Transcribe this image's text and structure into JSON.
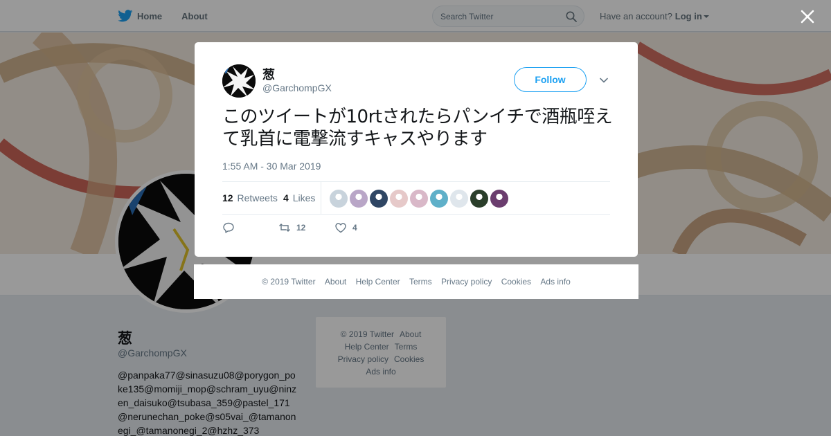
{
  "nav": {
    "home_label": "Home",
    "about_label": "About",
    "search_placeholder": "Search Twitter",
    "account_prompt": "Have an account?",
    "login_label": "Log in",
    "icons": [
      "twitter-bird-icon",
      "search-icon",
      "caret-down-icon",
      "close-icon"
    ]
  },
  "profile": {
    "name": "葱",
    "handle": "@GarchompGX",
    "bio": "@panpaka77@sinasuzu08@porygon_poke135@momiji_mop@schram_uyu@ninzen_daisuko@tsubasa_359@pastel_171@nerunechan_poke@s05vai_@tamanonegi_@tamanonegi_2@hzhz_373"
  },
  "side_footer": {
    "links": [
      "© 2019 Twitter",
      "About",
      "Help Center",
      "Terms",
      "Privacy policy",
      "Cookies",
      "Ads info"
    ]
  },
  "tweet": {
    "name": "葱",
    "handle": "@GarchompGX",
    "follow_label": "Follow",
    "text": "このツイートが10rtされたらパンイチで酒瓶咥えて乳首に電撃流すキャスやります",
    "timestamp": "1:55 AM - 30 Mar 2019",
    "retweets_count": "12",
    "retweets_label": "Retweets",
    "likes_count": "4",
    "likes_label": "Likes",
    "reply_count": "",
    "retweet_action_count": "12",
    "like_action_count": "4",
    "liker_colors": [
      "#c8d3dc",
      "#b9a6c7",
      "#2f4664",
      "#e6c9c9",
      "#d9b8c8",
      "#5fb0c9",
      "#dfe6ec",
      "#2a3e2a",
      "#6b3d6e"
    ]
  },
  "modal_footer": {
    "links": [
      "© 2019 Twitter",
      "About",
      "Help Center",
      "Terms",
      "Privacy policy",
      "Cookies",
      "Ads info"
    ]
  },
  "colors": {
    "accent": "#1da1f2",
    "text_primary": "#14171a",
    "text_secondary": "#657786"
  }
}
